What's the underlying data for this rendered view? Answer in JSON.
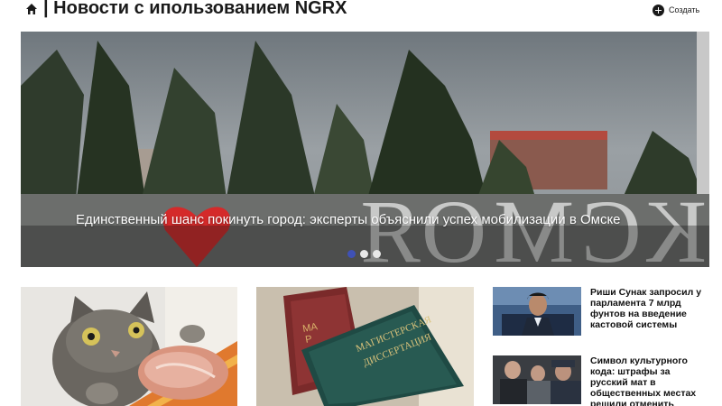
{
  "header": {
    "title": "| Новости с ипользованием NGRX",
    "create_label": "Создать"
  },
  "hero": {
    "title": "Единственный шанс покинуть город: эксперты объяснили успех мобилизации в Омске",
    "sign_text": "ЯОМСК",
    "slides": 3,
    "active_slide": 1
  },
  "articles": [
    {
      "title": "Риши Сунак запросил у парламента 7 млрд фунтов на введение кастовой системы"
    },
    {
      "title": "Символ культурного кода: штрафы за русский мат в общественных местах решили отменить"
    }
  ],
  "book_text": {
    "line1": "МАГИСТЕРСКАЯ",
    "line2": "ДИССЕРТАЦИЯ"
  },
  "colors": {
    "accent": "#3f51b5",
    "text": "#1a1a1a",
    "heart": "#d42a2a"
  }
}
